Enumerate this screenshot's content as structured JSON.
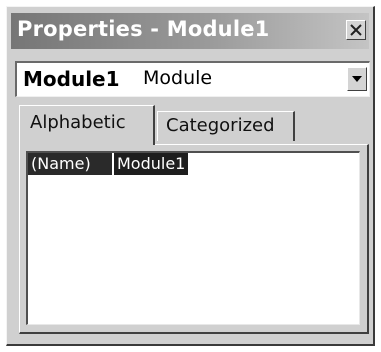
{
  "window": {
    "title": "Properties - Module1",
    "close_icon": "close-icon"
  },
  "object_selector": {
    "name": "Module1",
    "type": "Module",
    "dropdown_icon": "chevron-down-icon"
  },
  "tabs": [
    {
      "label": "Alphabetic",
      "selected": true
    },
    {
      "label": "Categorized",
      "selected": false
    }
  ],
  "properties": [
    {
      "name": "(Name)",
      "value": "Module1"
    }
  ]
}
